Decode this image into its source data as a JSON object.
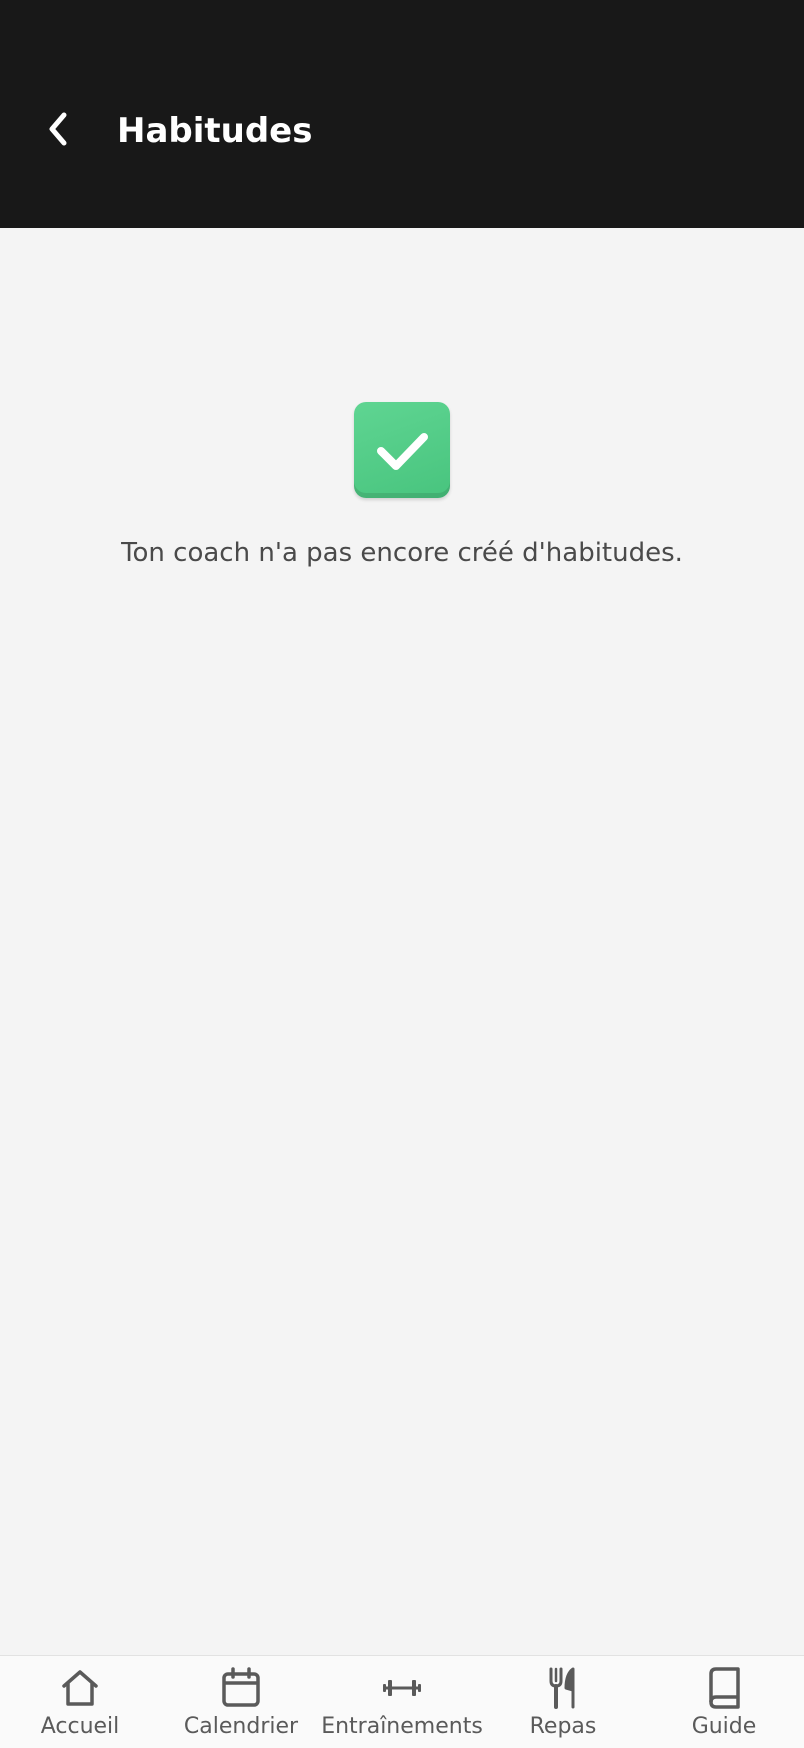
{
  "header": {
    "title": "Habitudes",
    "back_icon": "chevron-left-icon",
    "background_color": "#181818"
  },
  "empty_state": {
    "icon": "check-mark-button-icon",
    "icon_color": "#52cc87",
    "message": "Ton coach n'a pas encore créé d'habitudes."
  },
  "bottom_nav": {
    "items": [
      {
        "label": "Accueil",
        "icon": "home-icon"
      },
      {
        "label": "Calendrier",
        "icon": "calendar-icon"
      },
      {
        "label": "Entraînements",
        "icon": "dumbbell-icon"
      },
      {
        "label": "Repas",
        "icon": "fork-knife-icon"
      },
      {
        "label": "Guide",
        "icon": "book-icon"
      }
    ]
  }
}
